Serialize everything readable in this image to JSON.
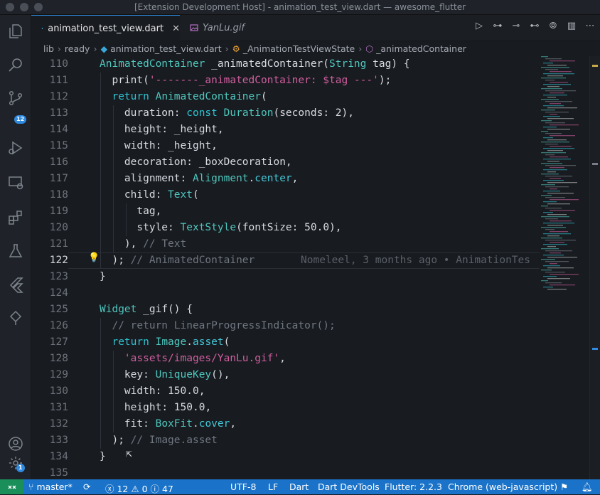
{
  "window": {
    "title": "[Extension Development Host] - animation_test_view.dart — awesome_flutter"
  },
  "activity_bar": {
    "source_control_badge": "12",
    "settings_badge": "1"
  },
  "tabs": [
    {
      "label": "animation_test_view.dart",
      "active": true
    },
    {
      "label": "YanLu.gif",
      "active": false
    }
  ],
  "breadcrumb": {
    "items": [
      "lib",
      "ready",
      "animation_test_view.dart",
      "_AnimationTestViewState",
      "_animatedContainer"
    ]
  },
  "editor": {
    "current_line": "122",
    "blame": "Nomeleel, 3 months ago • AnimationTes",
    "lines": [
      {
        "n": "110",
        "t": "AnimatedContainer _animatedContainer(String tag) {"
      },
      {
        "n": "111",
        "t": "  print('-------_animatedContainer: $tag ---');"
      },
      {
        "n": "112",
        "t": "  return AnimatedContainer("
      },
      {
        "n": "113",
        "t": "    duration: const Duration(seconds: 2),"
      },
      {
        "n": "114",
        "t": "    height: _height,"
      },
      {
        "n": "115",
        "t": "    width: _height,"
      },
      {
        "n": "116",
        "t": "    decoration: _boxDecoration,"
      },
      {
        "n": "117",
        "t": "    alignment: Alignment.center,"
      },
      {
        "n": "118",
        "t": "    child: Text("
      },
      {
        "n": "119",
        "t": "      tag,"
      },
      {
        "n": "120",
        "t": "      style: TextStyle(fontSize: 50.0),"
      },
      {
        "n": "121",
        "t": "    ), // Text"
      },
      {
        "n": "122",
        "t": "  ); // AnimatedContainer"
      },
      {
        "n": "123",
        "t": "}"
      },
      {
        "n": "124",
        "t": ""
      },
      {
        "n": "125",
        "t": "Widget _gif() {"
      },
      {
        "n": "126",
        "t": "  // return LinearProgressIndicator();"
      },
      {
        "n": "127",
        "t": "  return Image.asset("
      },
      {
        "n": "128",
        "t": "    'assets/images/YanLu.gif',"
      },
      {
        "n": "129",
        "t": "    key: UniqueKey(),"
      },
      {
        "n": "130",
        "t": "    width: 150.0,"
      },
      {
        "n": "131",
        "t": "    height: 150.0,"
      },
      {
        "n": "132",
        "t": "    fit: BoxFit.cover,"
      },
      {
        "n": "133",
        "t": "  ); // Image.asset"
      },
      {
        "n": "134",
        "t": "}"
      },
      {
        "n": "135",
        "t": ""
      }
    ]
  },
  "statusbar": {
    "branch": "master*",
    "errors": "12",
    "warnings": "0",
    "infos": "47",
    "encoding": "UTF-8",
    "eol": "LF",
    "language": "Dart",
    "devtools": "Dart DevTools",
    "flutter": "Flutter: 2.2.3",
    "device": "Chrome (web-javascript)"
  },
  "colors": {
    "accent": "#1a73c8",
    "remote": "#1a8f5a",
    "string": "#d05f9f",
    "type": "#4fc6bd"
  }
}
